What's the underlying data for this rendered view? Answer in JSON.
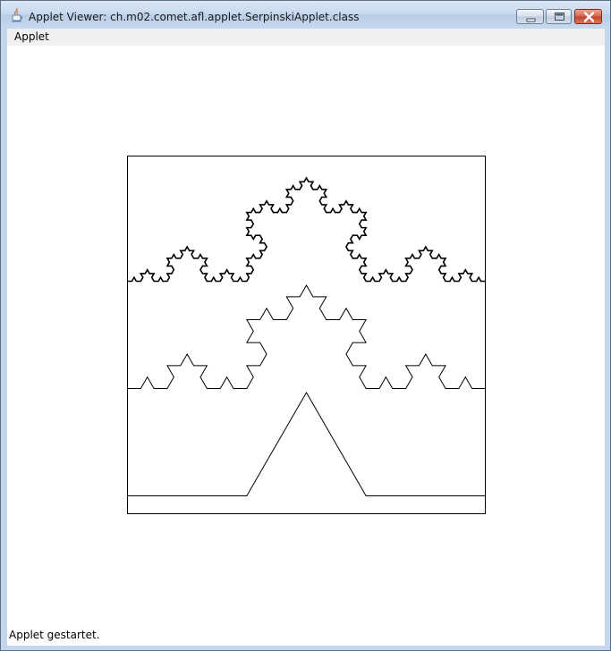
{
  "window": {
    "title": "Applet Viewer: ch.m02.comet.afl.applet.SerpinskiApplet.class",
    "icon": "java-cup-icon"
  },
  "menu": {
    "items": [
      "Applet"
    ]
  },
  "applet": {
    "curve": "koch",
    "levels": [
      1,
      3,
      4
    ],
    "box_color": "#000000",
    "stroke_color": "#000000"
  },
  "status": {
    "text": "Applet gestartet."
  }
}
